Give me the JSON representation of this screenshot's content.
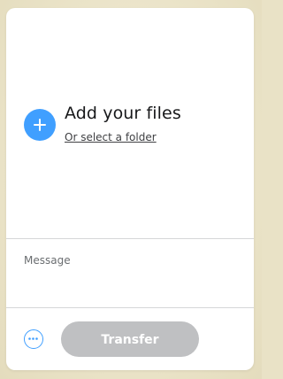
{
  "upload": {
    "add_icon": "plus-icon",
    "title": "Add your files",
    "select_folder_link": "Or select a folder"
  },
  "message": {
    "placeholder": "Message",
    "value": ""
  },
  "footer": {
    "options_icon": "more-horizontal-icon",
    "transfer_label": "Transfer",
    "transfer_enabled": false
  },
  "colors": {
    "accent": "#409fff",
    "disabled_button": "#bfc0c2",
    "background": "#e9e2c6",
    "card": "#ffffff",
    "divider": "#d6d7d8"
  }
}
